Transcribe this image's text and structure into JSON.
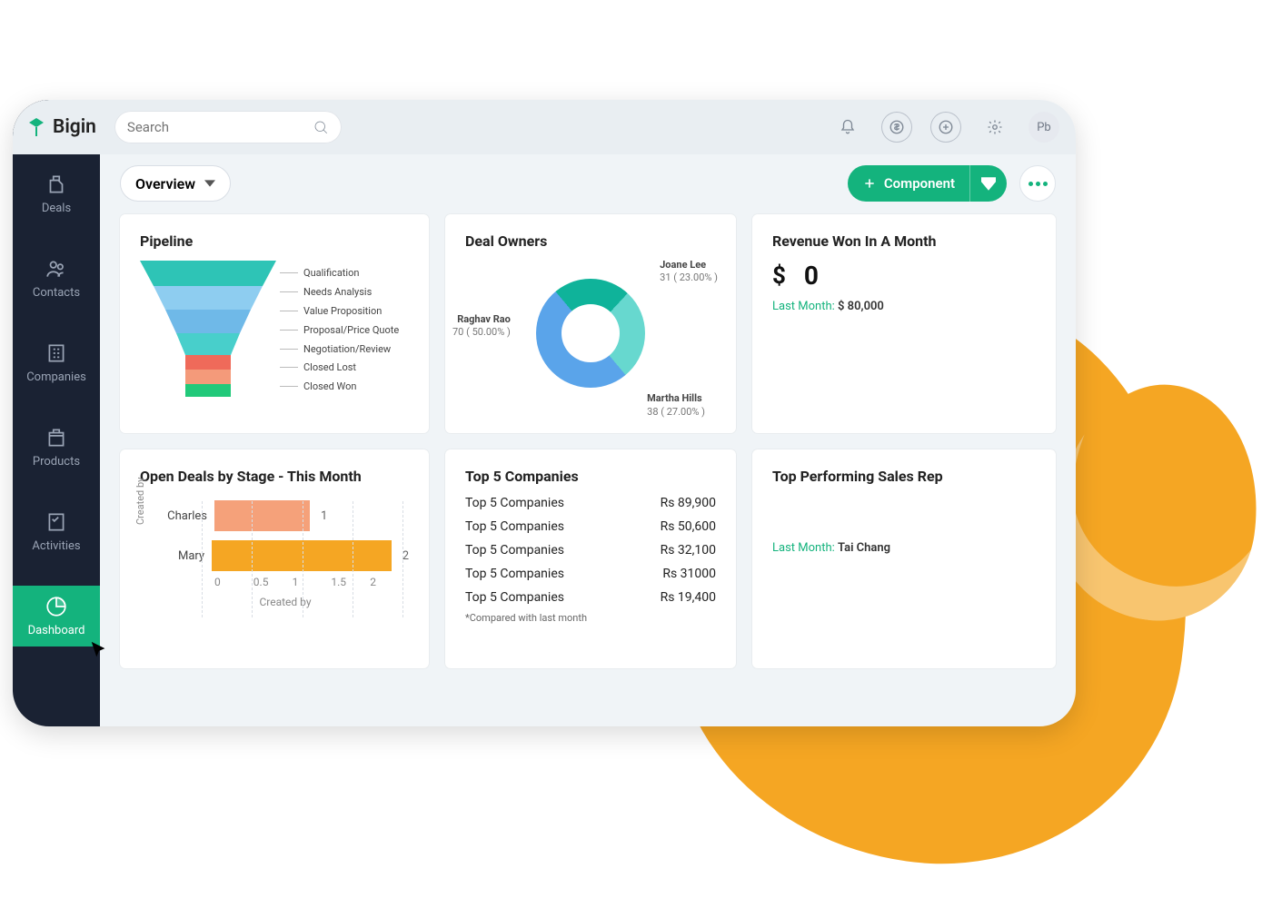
{
  "brand": "Bigin",
  "search_placeholder": "Search",
  "avatar_initials": "Pb",
  "sidebar": {
    "items": [
      {
        "label": "Deals"
      },
      {
        "label": "Contacts"
      },
      {
        "label": "Companies"
      },
      {
        "label": "Products"
      },
      {
        "label": "Activities"
      },
      {
        "label": "Dashboard"
      }
    ]
  },
  "page": {
    "dropdown_label": "Overview",
    "add_label": "Component"
  },
  "pipeline": {
    "title": "Pipeline",
    "stages": [
      "Qualification",
      "Needs Analysis",
      "Value Proposition",
      "Proposal/Price Quote",
      "Negotiation/Review",
      "Closed Lost",
      "Closed Won"
    ]
  },
  "deal_owners": {
    "title": "Deal Owners"
  },
  "open_deals": {
    "title": "Open Deals by Stage - This Month",
    "ylabel": "Created by",
    "xlabel": "Created by"
  },
  "top_companies": {
    "title": "Top 5 Companies",
    "note": "*Compared with last month",
    "rows": [
      {
        "name": "Top 5 Companies",
        "value": "Rs 89,900"
      },
      {
        "name": "Top 5 Companies",
        "value": "Rs 50,600"
      },
      {
        "name": "Top 5 Companies",
        "value": "Rs 32,100"
      },
      {
        "name": "Top 5 Companies",
        "value": "Rs 31000"
      },
      {
        "name": "Top 5 Companies",
        "value": "Rs 19,400"
      }
    ]
  },
  "revenue": {
    "title": "Revenue Won In A Month",
    "currency": "$",
    "value": "0",
    "sub_label": "Last Month:",
    "sub_value": "$ 80,000"
  },
  "top_rep": {
    "title": "Top Performing Sales Rep",
    "sub_label": "Last Month:",
    "sub_value": "Tai Chang"
  },
  "chart_data": [
    {
      "type": "pie",
      "title": "Deal Owners",
      "series": [
        {
          "name": "Joane Lee",
          "value": 31,
          "pct": 23.0,
          "color": "#0fb39a"
        },
        {
          "name": "Martha Hills",
          "value": 38,
          "pct": 27.0,
          "color": "#67d8cf"
        },
        {
          "name": "Raghav Rao",
          "value": 70,
          "pct": 50.0,
          "color": "#5aa4ea"
        }
      ]
    },
    {
      "type": "bar",
      "title": "Open Deals by Stage - This Month",
      "orientation": "horizontal",
      "xlabel": "Created by",
      "ylabel": "Created by",
      "xlim": [
        0,
        2
      ],
      "ticks": [
        0,
        0.5,
        1,
        1.5,
        2
      ],
      "categories": [
        "Charles",
        "Mary"
      ],
      "values": [
        1,
        2
      ],
      "colors": [
        "#f5a17a",
        "#f5a623"
      ]
    },
    {
      "type": "funnel",
      "title": "Pipeline",
      "stages": [
        {
          "name": "Qualification",
          "color": "#2ec4b6"
        },
        {
          "name": "Needs Analysis",
          "color": "#8ecdf0"
        },
        {
          "name": "Value Proposition",
          "color": "#6fb9e8"
        },
        {
          "name": "Proposal/Price Quote",
          "color": "#48cfcb"
        },
        {
          "name": "Negotiation/Review",
          "color": "#ef6a5a"
        },
        {
          "name": "Closed Lost",
          "color": "#f49a7a"
        },
        {
          "name": "Closed Won",
          "color": "#22c97a"
        }
      ]
    }
  ]
}
